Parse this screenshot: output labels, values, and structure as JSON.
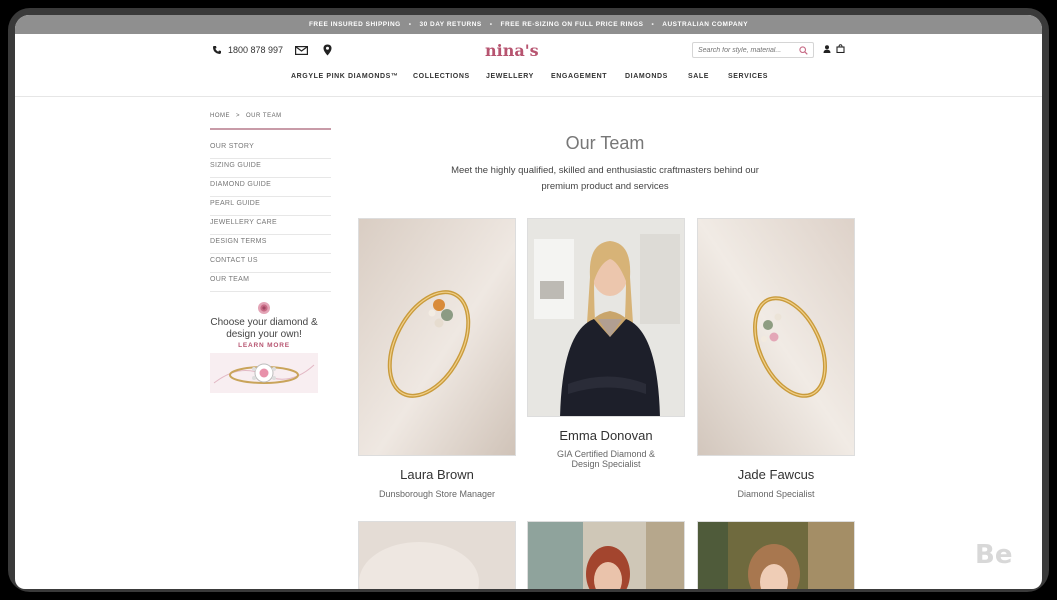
{
  "topbar": {
    "items": [
      "FREE INSURED SHIPPING",
      "30 DAY RETURNS",
      "FREE RE-SIZING ON FULL PRICE RINGS",
      "AUSTRALIAN COMPANY"
    ],
    "separator": "•"
  },
  "header": {
    "phone": "1800 878 997",
    "logo": "nina's",
    "search_placeholder": "Search for style, material..."
  },
  "nav": [
    "ARGYLE PINK DIAMONDS™",
    "COLLECTIONS",
    "JEWELLERY",
    "ENGAGEMENT",
    "DIAMONDS",
    "SALE",
    "SERVICES"
  ],
  "breadcrumb": [
    "HOME",
    ">",
    "OUR TEAM"
  ],
  "sidebar": [
    "OUR STORY",
    "SIZING GUIDE",
    "DIAMOND GUIDE",
    "PEARL GUIDE",
    "JEWELLERY CARE",
    "DESIGN TERMS",
    "CONTACT US",
    "OUR TEAM"
  ],
  "promo": {
    "headline": "Choose your diamond & design your own!",
    "cta": "LEARN MORE"
  },
  "page": {
    "title": "Our Team",
    "intro": "Meet the highly qualified, skilled and enthusiastic craftmasters behind our premium product and services"
  },
  "team": [
    {
      "name": "Laura Brown",
      "role": "Dunsborough Store Manager"
    },
    {
      "name": "Emma Donovan",
      "role": "GIA Certified Diamond & Design Specialist"
    },
    {
      "name": "Jade Fawcus",
      "role": "Diamond Specialist"
    }
  ],
  "watermark": "Be",
  "colors": {
    "brand": "#b75470",
    "topbar": "#8f8f8f"
  },
  "icons": [
    "phone-icon",
    "mail-icon",
    "location-pin-icon",
    "search-icon",
    "user-icon",
    "shopping-bag-icon",
    "rose-icon"
  ]
}
